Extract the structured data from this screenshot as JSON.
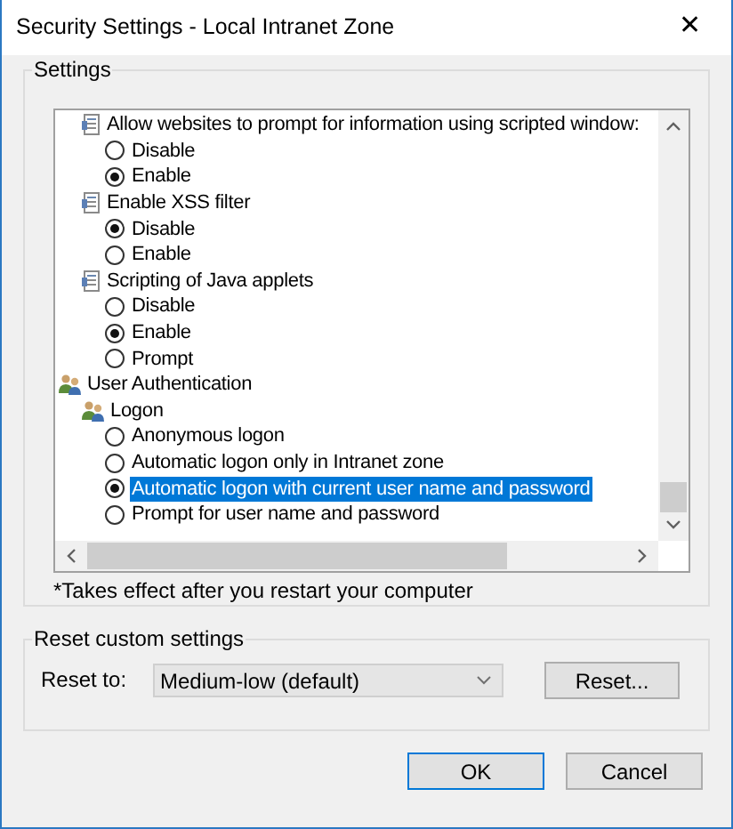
{
  "window": {
    "title": "Security Settings - Local Intranet Zone",
    "close": "✕"
  },
  "settings_group": {
    "title": "Settings"
  },
  "tree": [
    {
      "children": [
        {
          "kind": "setting",
          "label": "Allow websites to prompt for information using scripted window:",
          "children": [
            {
              "kind": "option",
              "label": "Disable",
              "selected": false,
              "focused": false
            },
            {
              "kind": "option",
              "label": "Enable",
              "selected": true,
              "focused": false
            }
          ]
        },
        {
          "kind": "setting",
          "label": "Enable XSS filter",
          "children": [
            {
              "kind": "option",
              "label": "Disable",
              "selected": true,
              "focused": false
            },
            {
              "kind": "option",
              "label": "Enable",
              "selected": false,
              "focused": false
            }
          ]
        },
        {
          "kind": "setting",
          "label": "Scripting of Java applets",
          "children": [
            {
              "kind": "option",
              "label": "Disable",
              "selected": false,
              "focused": false
            },
            {
              "kind": "option",
              "label": "Enable",
              "selected": true,
              "focused": false
            },
            {
              "kind": "option",
              "label": "Prompt",
              "selected": false,
              "focused": false
            }
          ]
        }
      ]
    },
    {
      "kind": "group",
      "label": "User Authentication",
      "children": [
        {
          "kind": "group",
          "label": "Logon",
          "children": [
            {
              "kind": "option",
              "label": "Anonymous logon",
              "selected": false,
              "focused": false
            },
            {
              "kind": "option",
              "label": "Automatic logon only in Intranet zone",
              "selected": false,
              "focused": false
            },
            {
              "kind": "option",
              "label": "Automatic logon with current user name and password",
              "selected": true,
              "focused": true
            },
            {
              "kind": "option",
              "label": "Prompt for user name and password",
              "selected": false,
              "focused": false
            }
          ]
        }
      ]
    }
  ],
  "note": "*Takes effect after you restart your computer",
  "reset_group": {
    "title": "Reset custom settings",
    "label": "Reset to:",
    "value": "Medium-low (default)",
    "button": "Reset..."
  },
  "buttons": [
    {
      "label": "OK",
      "default": true
    },
    {
      "label": "Cancel",
      "default": false
    }
  ]
}
